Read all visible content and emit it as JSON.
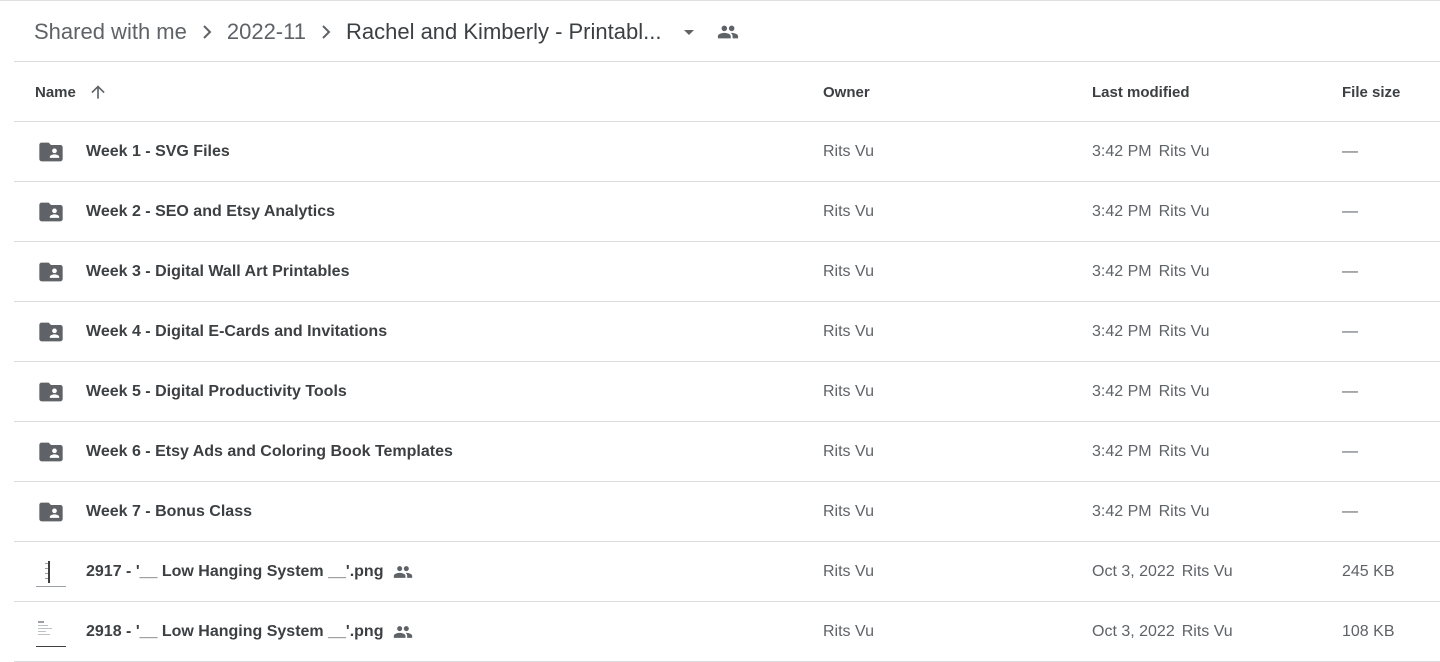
{
  "breadcrumb": {
    "items": [
      "Shared with me",
      "2022-11",
      "Rachel and Kimberly - Printabl..."
    ],
    "separator_icon": "chevron-right-icon",
    "dropdown_icon": "caret-down-icon",
    "shared_icon": "people-icon"
  },
  "table": {
    "columns": {
      "name": "Name",
      "owner": "Owner",
      "modified": "Last modified",
      "size": "File size"
    },
    "sort_icon": "arrow-up-icon",
    "rows": [
      {
        "type": "folder",
        "name": "Week 1 - SVG Files",
        "owner": "Rits Vu",
        "modified_time": "3:42 PM",
        "modified_by": "Rits Vu",
        "size": "—"
      },
      {
        "type": "folder",
        "name": "Week 2 - SEO and Etsy Analytics",
        "owner": "Rits Vu",
        "modified_time": "3:42 PM",
        "modified_by": "Rits Vu",
        "size": "—"
      },
      {
        "type": "folder",
        "name": "Week 3 - Digital Wall Art Printables",
        "owner": "Rits Vu",
        "modified_time": "3:42 PM",
        "modified_by": "Rits Vu",
        "size": "—"
      },
      {
        "type": "folder",
        "name": "Week 4 - Digital E-Cards and Invitations",
        "owner": "Rits Vu",
        "modified_time": "3:42 PM",
        "modified_by": "Rits Vu",
        "size": "—"
      },
      {
        "type": "folder",
        "name": "Week 5 - Digital Productivity Tools",
        "owner": "Rits Vu",
        "modified_time": "3:42 PM",
        "modified_by": "Rits Vu",
        "size": "—"
      },
      {
        "type": "folder",
        "name": "Week 6 - Etsy Ads and Coloring Book Templates",
        "owner": "Rits Vu",
        "modified_time": "3:42 PM",
        "modified_by": "Rits Vu",
        "size": "—"
      },
      {
        "type": "folder",
        "name": "Week 7 - Bonus Class",
        "owner": "Rits Vu",
        "modified_time": "3:42 PM",
        "modified_by": "Rits Vu",
        "size": "—"
      },
      {
        "type": "image",
        "name": "2917 - '__ Low Hanging System __'.png",
        "owner": "Rits Vu",
        "modified_time": "Oct 3, 2022",
        "modified_by": "Rits Vu",
        "size": "245 KB"
      },
      {
        "type": "image",
        "name": "2918 - '__ Low Hanging System __'.png",
        "owner": "Rits Vu",
        "modified_time": "Oct 3, 2022",
        "modified_by": "Rits Vu",
        "size": "108 KB"
      }
    ]
  },
  "colors": {
    "icon": "#5f6368",
    "divider": "#dadce0",
    "text_primary": "#3c4043",
    "text_secondary": "#5f6368"
  }
}
